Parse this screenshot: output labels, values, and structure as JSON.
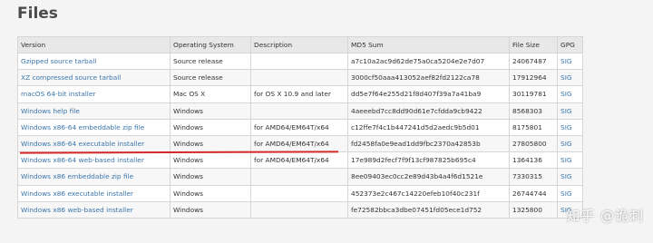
{
  "page": {
    "title": "Files"
  },
  "table": {
    "headers": [
      "Version",
      "Operating System",
      "Description",
      "MD5 Sum",
      "File Size",
      "GPG"
    ],
    "rows": [
      {
        "version": "Gzipped source tarball",
        "os": "Source release",
        "description": "",
        "md5": "a7c10a2ac9d62de75a0ca5204e2e7d07",
        "size": "24067487",
        "gpg": "SIG"
      },
      {
        "version": "XZ compressed source tarball",
        "os": "Source release",
        "description": "",
        "md5": "3000cf50aaa413052aef82fd2122ca78",
        "size": "17912964",
        "gpg": "SIG"
      },
      {
        "version": "macOS 64-bit installer",
        "os": "Mac OS X",
        "description": "for OS X 10.9 and later",
        "md5": "dd5e7f64e255d21f8d407f39a7a41ba9",
        "size": "30119781",
        "gpg": "SIG"
      },
      {
        "version": "Windows help file",
        "os": "Windows",
        "description": "",
        "md5": "4aeeebd7cc8dd90d61e7cfdda9cb9422",
        "size": "8568303",
        "gpg": "SIG"
      },
      {
        "version": "Windows x86-64 embeddable zip file",
        "os": "Windows",
        "description": "for AMD64/EM64T/x64",
        "md5": "c12ffe7f4c1b447241d5d2aedc9b5d01",
        "size": "8175801",
        "gpg": "SIG"
      },
      {
        "version": "Windows x86-64 executable installer",
        "os": "Windows",
        "description": "for AMD64/EM64T/x64",
        "md5": "fd2458fa0e9ead1dd9fbc2370a42853b",
        "size": "27805800",
        "gpg": "SIG"
      },
      {
        "version": "Windows x86-64 web-based installer",
        "os": "Windows",
        "description": "for AMD64/EM64T/x64",
        "md5": "17e989d2fecf7f9f13cf987825b695c4",
        "size": "1364136",
        "gpg": "SIG"
      },
      {
        "version": "Windows x86 embeddable zip file",
        "os": "Windows",
        "description": "",
        "md5": "8ee09403ec0cc2e89d43b4a4f6d1521e",
        "size": "7330315",
        "gpg": "SIG"
      },
      {
        "version": "Windows x86 executable installer",
        "os": "Windows",
        "description": "",
        "md5": "452373e2c467c14220efeb10f40c231f",
        "size": "26744744",
        "gpg": "SIG"
      },
      {
        "version": "Windows x86 web-based installer",
        "os": "Windows",
        "description": "",
        "md5": "fe72582bbca3dbe07451fd05ece1d752",
        "size": "1325800",
        "gpg": "SIG"
      }
    ]
  },
  "watermark": "知乎 @诡刺",
  "colors": {
    "link": "#3b76ad",
    "highlight_underline": "#d42a2a",
    "header_bg": "#e8e8e8"
  }
}
